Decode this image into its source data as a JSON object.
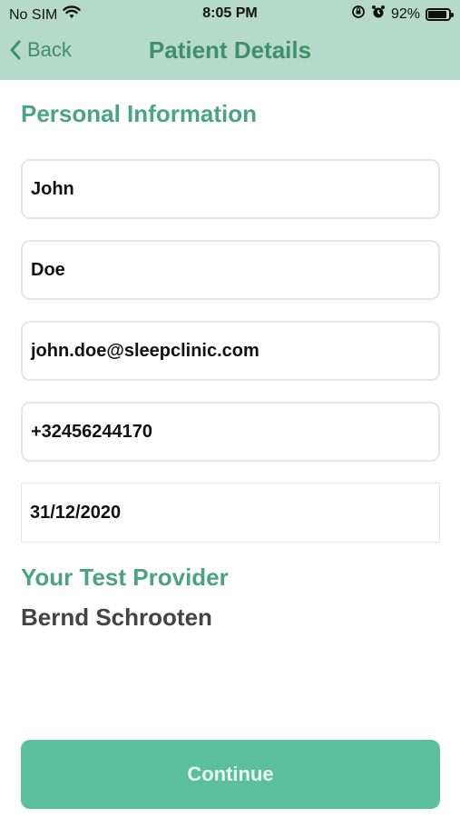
{
  "status": {
    "carrier": "No SIM",
    "time": "8:05 PM",
    "battery_percent_label": "92%",
    "battery_level": 0.92,
    "icons": [
      "wifi-icon",
      "orientation-lock-icon",
      "alarm-icon",
      "battery-icon"
    ]
  },
  "nav": {
    "back_label": "Back",
    "title": "Patient Details"
  },
  "personal": {
    "heading": "Personal Information",
    "first_name": "John",
    "last_name": "Doe",
    "email": "john.doe@sleepclinic.com",
    "phone": "+32456244170",
    "birthdate": "31/12/2020"
  },
  "provider": {
    "heading": "Your Test Provider",
    "name": "Bernd Schrooten"
  },
  "actions": {
    "continue_label": "Continue"
  },
  "colors": {
    "header_bg": "#b5dacb",
    "accent": "#4aa384",
    "button_bg": "#5bbf9e"
  }
}
